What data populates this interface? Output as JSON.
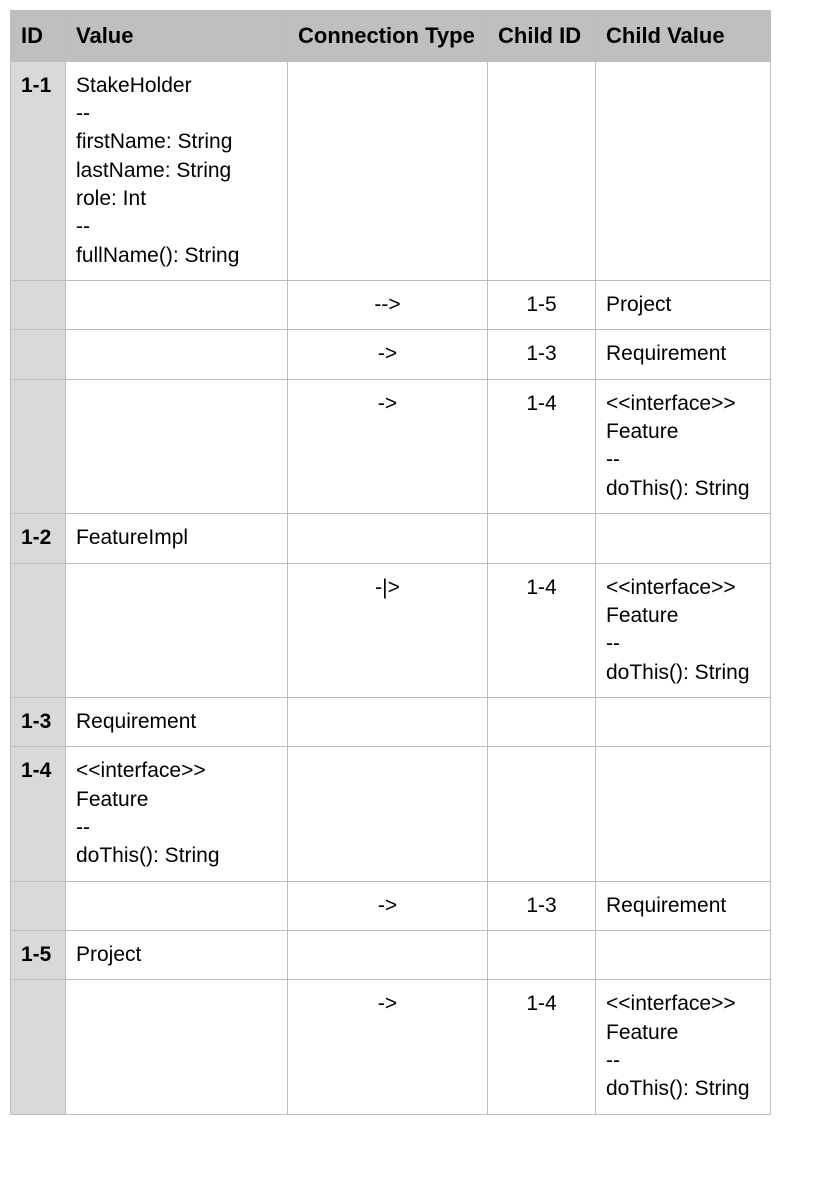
{
  "headers": {
    "id": "ID",
    "value": "Value",
    "connection_type": "Connection Type",
    "child_id": "Child ID",
    "child_value": "Child Value"
  },
  "rows": [
    {
      "id": "1-1",
      "value": "StakeHolder\n--\nfirstName: String\nlastName: String\nrole: Int\n--\nfullName(): String",
      "connection_type": "",
      "child_id": "",
      "child_value": ""
    },
    {
      "id": "",
      "value": "",
      "connection_type": "-->",
      "child_id": "1-5",
      "child_value": "Project"
    },
    {
      "id": "",
      "value": "",
      "connection_type": "->",
      "child_id": "1-3",
      "child_value": "Requirement"
    },
    {
      "id": "",
      "value": "",
      "connection_type": "->",
      "child_id": "1-4",
      "child_value": "<<interface>>\nFeature\n--\ndoThis(): String"
    },
    {
      "id": "1-2",
      "value": "FeatureImpl",
      "connection_type": "",
      "child_id": "",
      "child_value": ""
    },
    {
      "id": "",
      "value": "",
      "connection_type": "-|>",
      "child_id": "1-4",
      "child_value": "<<interface>>\nFeature\n--\ndoThis(): String"
    },
    {
      "id": "1-3",
      "value": "Requirement",
      "connection_type": "",
      "child_id": "",
      "child_value": ""
    },
    {
      "id": "1-4",
      "value": "<<interface>>\nFeature\n--\ndoThis(): String",
      "connection_type": "",
      "child_id": "",
      "child_value": ""
    },
    {
      "id": "",
      "value": "",
      "connection_type": "->",
      "child_id": "1-3",
      "child_value": "Requirement"
    },
    {
      "id": "1-5",
      "value": "Project",
      "connection_type": "",
      "child_id": "",
      "child_value": ""
    },
    {
      "id": "",
      "value": "",
      "connection_type": "->",
      "child_id": "1-4",
      "child_value": "<<interface>>\nFeature\n--\ndoThis(): String"
    }
  ]
}
